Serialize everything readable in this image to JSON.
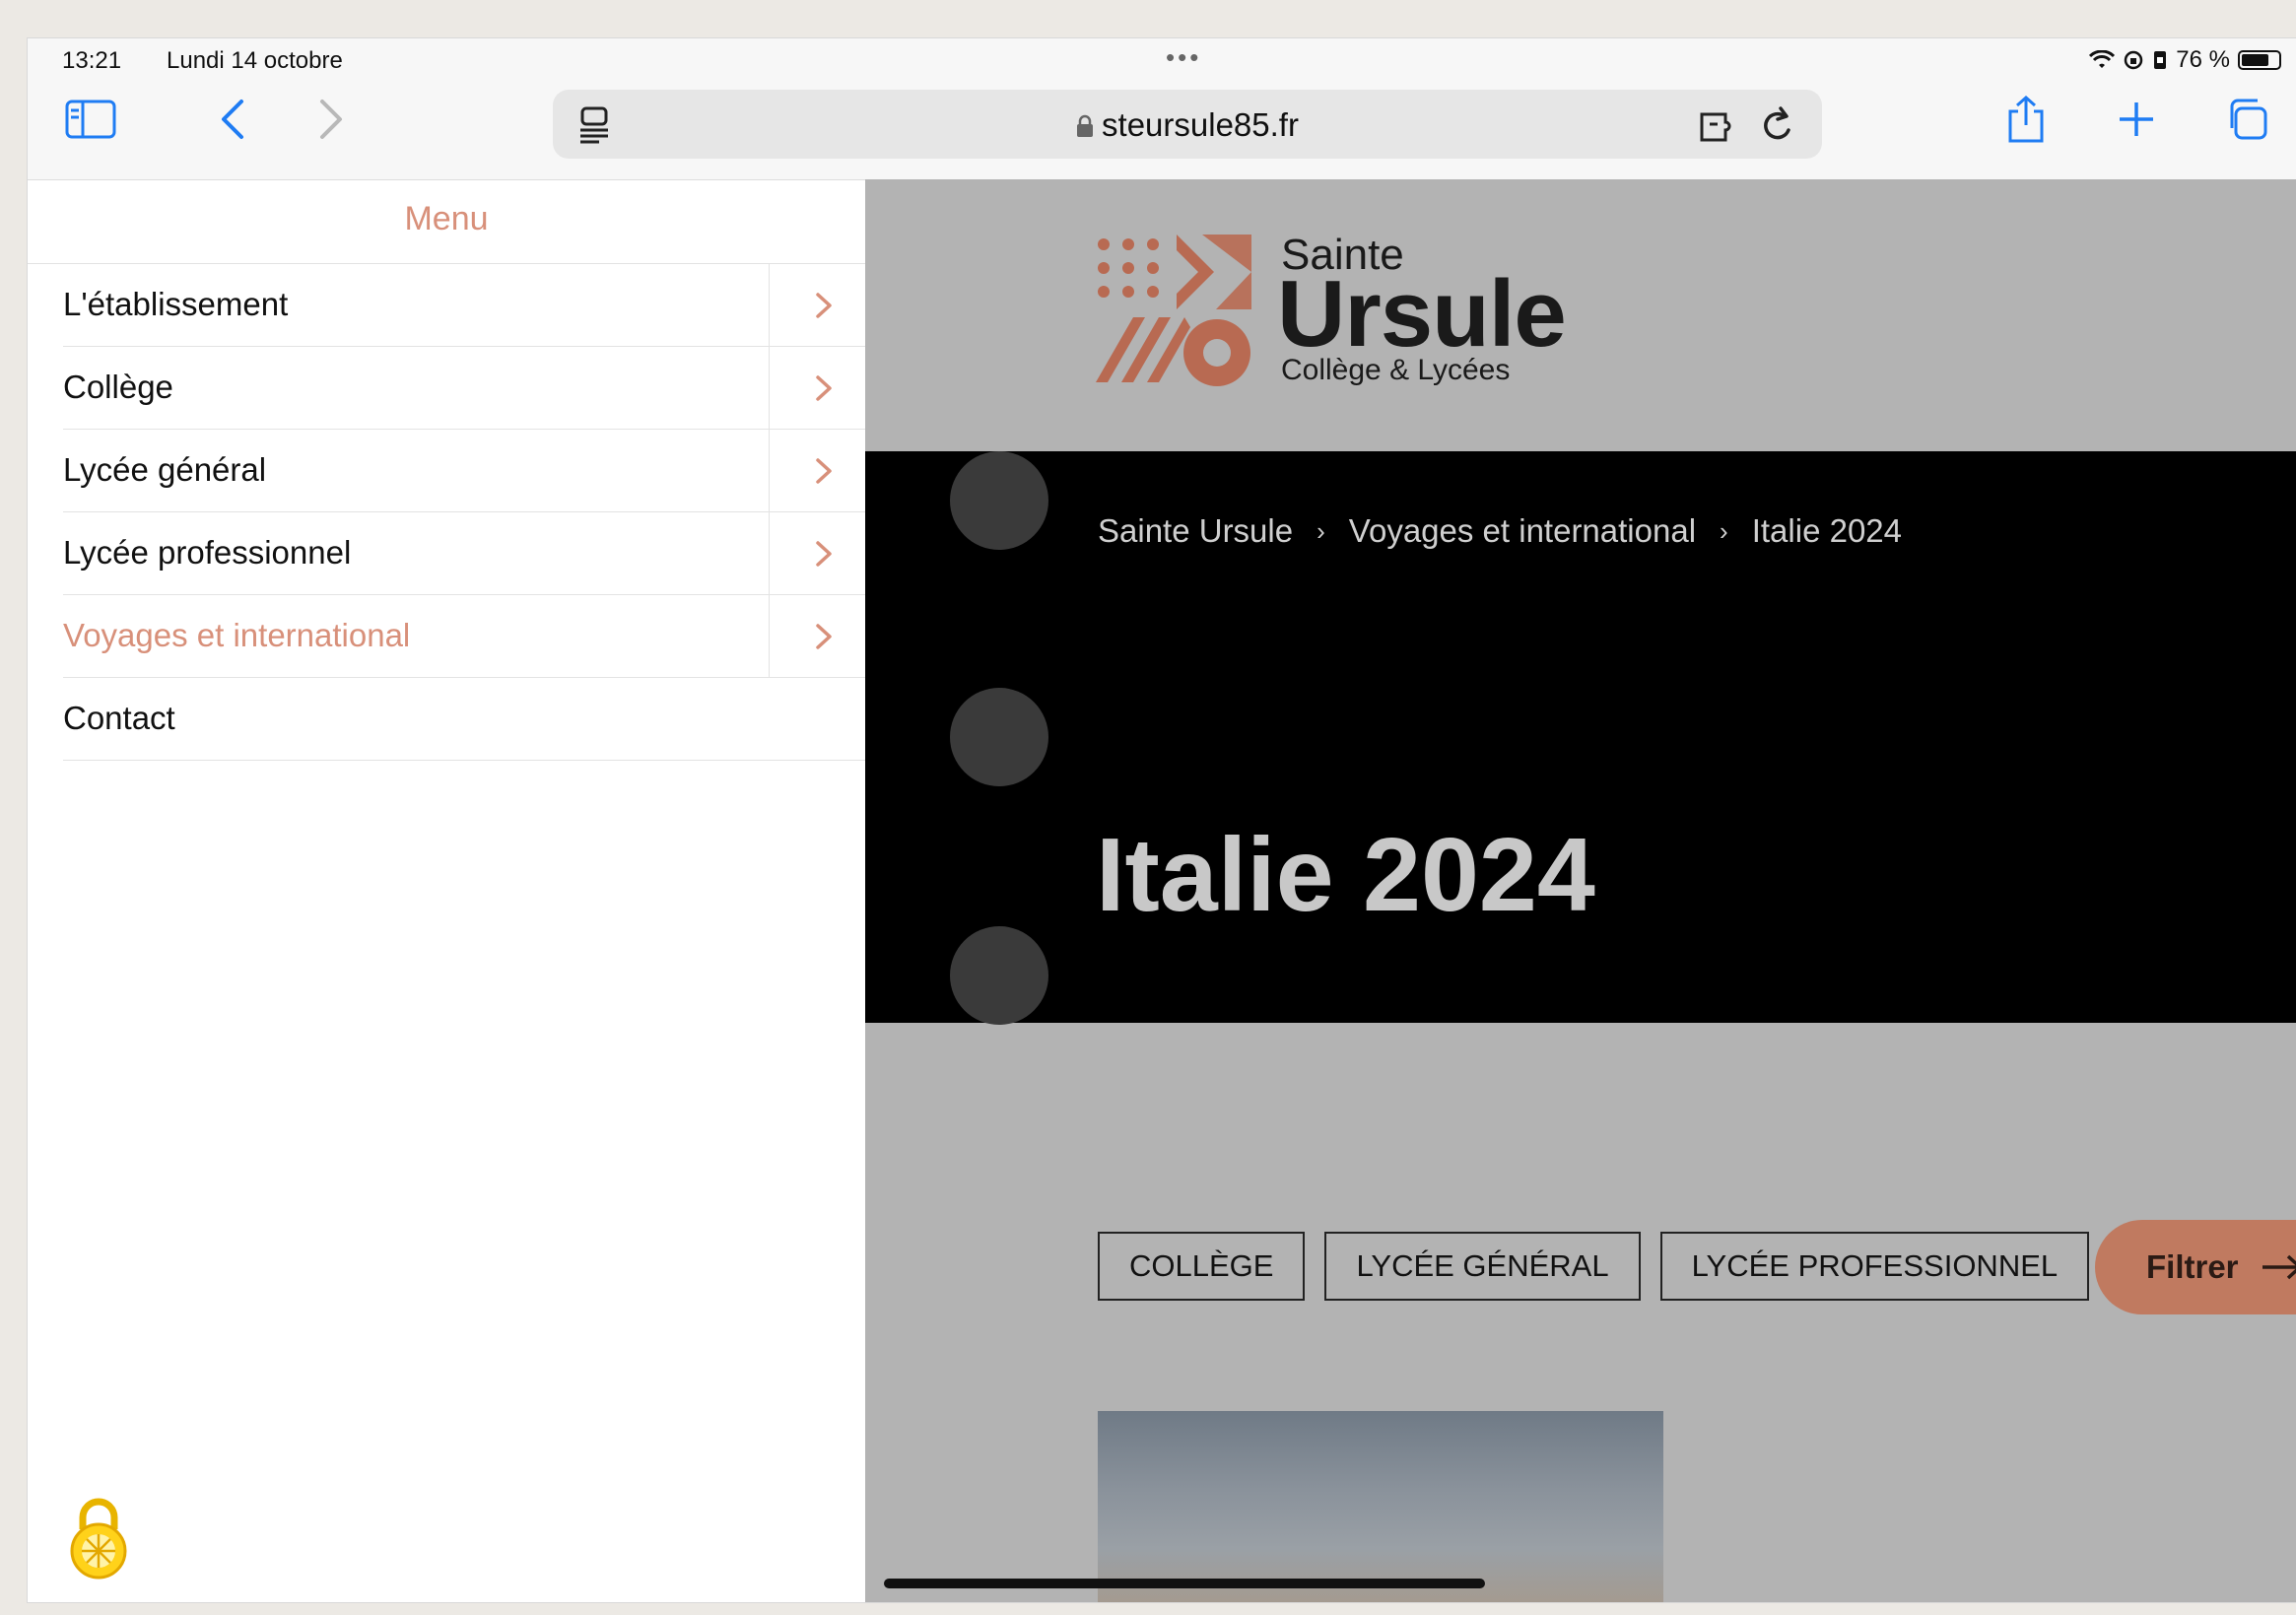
{
  "status_bar": {
    "time": "13:21",
    "date": "Lundi 14 octobre",
    "battery": "76 %",
    "battery_level": 0.76
  },
  "browser": {
    "url": "steursule85.fr"
  },
  "menu": {
    "title": "Menu",
    "items": [
      {
        "label": "L'établissement",
        "has_submenu": true
      },
      {
        "label": "Collège",
        "has_submenu": true
      },
      {
        "label": "Lycée général",
        "has_submenu": true
      },
      {
        "label": "Lycée professionnel",
        "has_submenu": true
      },
      {
        "label": "Voyages et international",
        "has_submenu": true,
        "active": true
      },
      {
        "label": "Contact",
        "has_submenu": false
      }
    ]
  },
  "site": {
    "logo": {
      "line1": "Sainte",
      "line2": "Ursule",
      "line3": "Collège & Lycées"
    },
    "breadcrumb": [
      "Sainte Ursule",
      "Voyages et international",
      "Italie 2024"
    ],
    "page_title": "Italie 2024",
    "filters": [
      "COLLÈGE",
      "LYCÉE GÉNÉRAL",
      "LYCÉE PROFESSIONNEL"
    ],
    "filter_button": "Filtrer"
  },
  "colors": {
    "accent": "#d8907a",
    "brand": "#c07a60",
    "hero_bg": "#000000",
    "overlay": "#b3b3b3"
  }
}
